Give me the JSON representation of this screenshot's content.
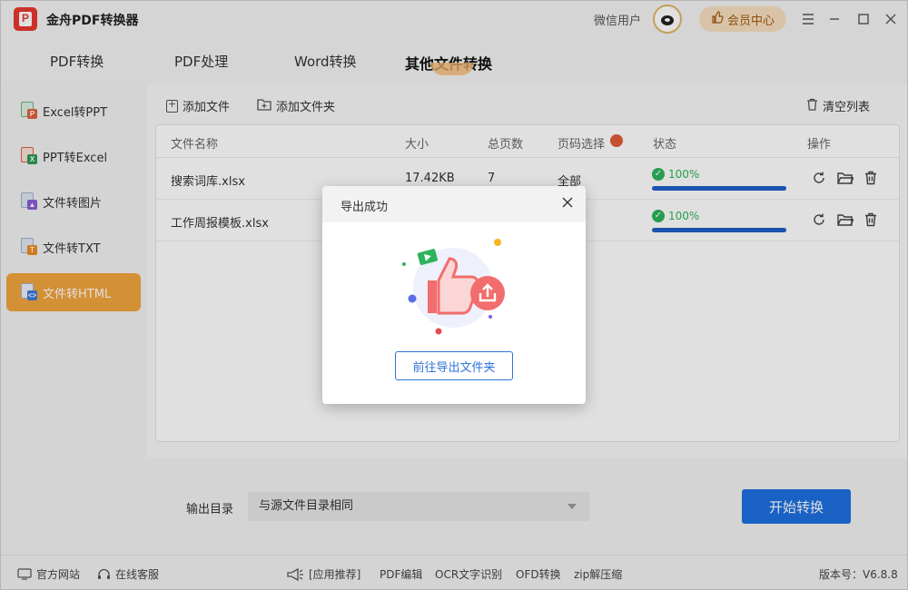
{
  "app": {
    "title": "金舟PDF转换器",
    "user_name": "微信用户",
    "vip_label": "会员中心",
    "accent_color": "#f2a43c",
    "primary_color": "#1d6fe0"
  },
  "window_controls": [
    "menu-icon",
    "minimize-icon",
    "maximize-icon",
    "close-icon"
  ],
  "tabs": [
    {
      "label": "PDF转换",
      "active": false
    },
    {
      "label": "PDF处理",
      "active": false
    },
    {
      "label": "Word转换",
      "active": false
    },
    {
      "label": "其他文件转换",
      "active": true
    }
  ],
  "sidebar": {
    "items": [
      {
        "label": "Excel转PPT",
        "icon": "excel-to-ppt-icon",
        "active": false
      },
      {
        "label": "PPT转Excel",
        "icon": "ppt-to-excel-icon",
        "active": false
      },
      {
        "label": "文件转图片",
        "icon": "file-to-image-icon",
        "active": false
      },
      {
        "label": "文件转TXT",
        "icon": "file-to-txt-icon",
        "active": false
      },
      {
        "label": "文件转HTML",
        "icon": "file-to-html-icon",
        "active": true
      }
    ]
  },
  "toolbar": {
    "add_file": "添加文件",
    "add_folder": "添加文件夹",
    "clear_list": "清空列表"
  },
  "table": {
    "columns": [
      "文件名称",
      "大小",
      "总页数",
      "页码选择",
      "状态",
      "操作"
    ],
    "rows": [
      {
        "name": "搜索词库.xlsx",
        "size": "17.42KB",
        "pages": "7",
        "page_select": "全部",
        "status": "100%",
        "progress": 1.0
      },
      {
        "name": "工作周报模板.xlsx",
        "size": "",
        "pages": "",
        "page_select": "",
        "status": "100%",
        "progress": 1.0
      }
    ]
  },
  "output": {
    "label": "输出目录",
    "value": "与源文件目录相同",
    "start_button": "开始转换"
  },
  "footer": {
    "website": "官方网站",
    "support": "在线客服",
    "recommend": "[应用推荐]",
    "links": [
      "PDF编辑",
      "OCR文字识别",
      "OFD转换",
      "zip解压缩"
    ],
    "version": "版本号：V6.8.8"
  },
  "modal": {
    "title": "导出成功",
    "button": "前往导出文件夹"
  }
}
